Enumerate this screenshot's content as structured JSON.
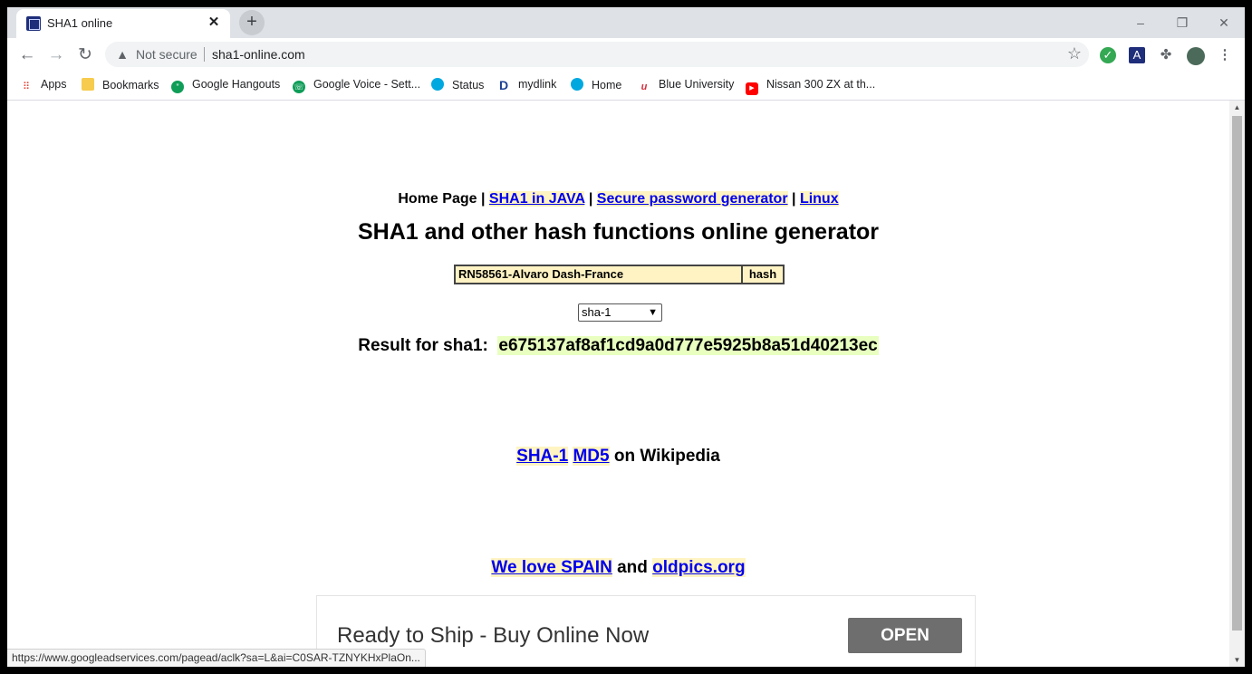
{
  "tab": {
    "title": "SHA1 online",
    "close": "✕",
    "new_tab": "+"
  },
  "window_controls": {
    "minimize": "–",
    "restore": "❐",
    "close": "✕"
  },
  "toolbar": {
    "back": "←",
    "forward": "→",
    "reload": "↻",
    "security_label": "Not secure",
    "url": "sha1-online.com",
    "bookmark_star": "☆"
  },
  "bookmarks": [
    {
      "label": "Apps",
      "icon": "apps-grid-icon",
      "color": "#ea4335"
    },
    {
      "label": "Bookmarks",
      "icon": "folder-icon",
      "color": "#f7cb4d"
    },
    {
      "label": "Google Hangouts",
      "icon": "hangouts-icon",
      "color": "#0f9d58"
    },
    {
      "label": "Google Voice - Sett...",
      "icon": "voice-icon",
      "color": "#0f9d58"
    },
    {
      "label": "Status",
      "icon": "att-icon",
      "color": "#00a8e0"
    },
    {
      "label": "mydlink",
      "icon": "dlink-icon",
      "color": "#1c3f94"
    },
    {
      "label": "Home",
      "icon": "att-icon",
      "color": "#00a8e0"
    },
    {
      "label": "Blue University",
      "icon": "u-logo-icon",
      "color": "#d4303b"
    },
    {
      "label": "Nissan 300 ZX at th...",
      "icon": "youtube-icon",
      "color": "#ff0000"
    }
  ],
  "page": {
    "nav": {
      "home": "Home Page",
      "sep": "|",
      "link1": "SHA1 in JAVA",
      "link2": "Secure password generator",
      "link3": "Linux"
    },
    "heading": "SHA1 and other hash functions online generator",
    "input_value": "RN58561-Alvaro Dash-France",
    "hash_button": "hash",
    "algorithm": "sha-1",
    "result_label": "Result for sha1:",
    "result_hash": "e675137af8af1cd9a0d777e5925b8a51d40213ec",
    "wiki": {
      "link1": "SHA-1",
      "link2": "MD5",
      "suffix": "on Wikipedia"
    },
    "footer": {
      "link1": "We love SPAIN",
      "mid": "and",
      "link2": "oldpics.org"
    }
  },
  "ad": {
    "text": "Ready to Ship - Buy Online Now",
    "button": "OPEN"
  },
  "status_url": "https://www.googleadservices.com/pagead/aclk?sa=L&ai=C0SAR-TZNYKHxPlaOn..."
}
